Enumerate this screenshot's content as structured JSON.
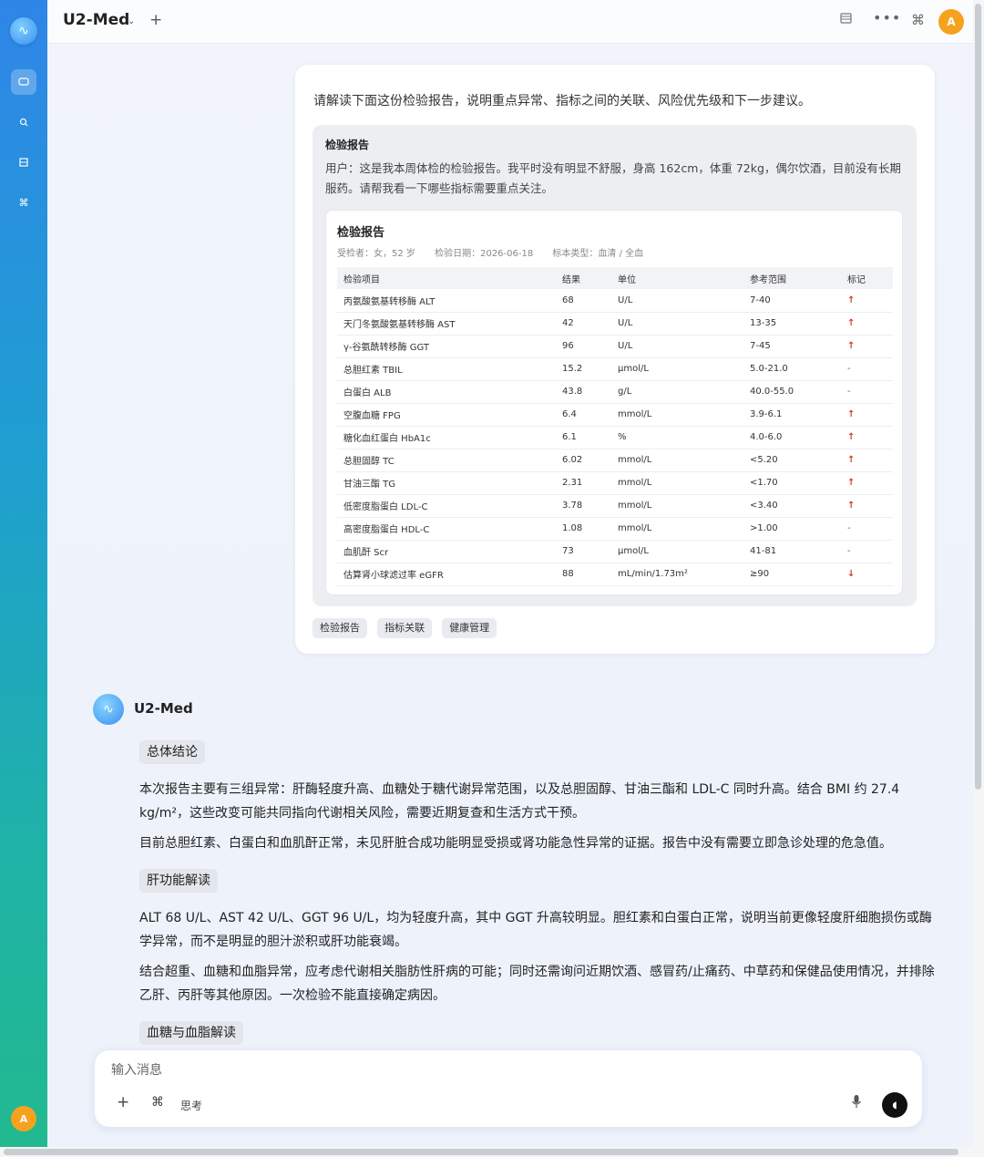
{
  "app": {
    "title": "U2-Med",
    "chevron": "⌄",
    "new_tab": "+"
  },
  "header": {
    "avatar": "A",
    "icons": [
      "sidebar-toggle-icon",
      "more-icon",
      "command-icon"
    ]
  },
  "rail": {
    "logo": "∿",
    "items": [
      "chat-icon",
      "search-icon",
      "library-icon",
      "command-icon"
    ],
    "avatar": "A"
  },
  "user_message": {
    "prompt": "请解读下面这份检验报告，说明重点异常、指标之间的关联、风险优先级和下一步建议。",
    "attachment_title": "检验报告",
    "attachment_desc": "用户：这是我本周体检的检验报告。我平时没有明显不舒服，身高 162cm，体重 72kg，偶尔饮酒，目前没有长期服药。请帮我看一下哪些指标需要重点关注。",
    "report": {
      "title": "检验报告",
      "subject": "受检者：女，52 岁",
      "date": "检验日期：2026-06-18",
      "sample": "标本类型：血清 / 全血",
      "headers": [
        "检验项目",
        "结果",
        "单位",
        "参考范围",
        "标记"
      ],
      "rows": [
        [
          "丙氨酸氨基转移酶 ALT",
          "68",
          "U/L",
          "7-40",
          "↑"
        ],
        [
          "天门冬氨酸氨基转移酶 AST",
          "42",
          "U/L",
          "13-35",
          "↑"
        ],
        [
          "γ-谷氨酰转移酶 GGT",
          "96",
          "U/L",
          "7-45",
          "↑"
        ],
        [
          "总胆红素 TBIL",
          "15.2",
          "μmol/L",
          "5.0-21.0",
          "-"
        ],
        [
          "白蛋白 ALB",
          "43.8",
          "g/L",
          "40.0-55.0",
          "-"
        ],
        [
          "空腹血糖 FPG",
          "6.4",
          "mmol/L",
          "3.9-6.1",
          "↑"
        ],
        [
          "糖化血红蛋白 HbA1c",
          "6.1",
          "%",
          "4.0-6.0",
          "↑"
        ],
        [
          "总胆固醇 TC",
          "6.02",
          "mmol/L",
          "<5.20",
          "↑"
        ],
        [
          "甘油三酯 TG",
          "2.31",
          "mmol/L",
          "<1.70",
          "↑"
        ],
        [
          "低密度脂蛋白 LDL-C",
          "3.78",
          "mmol/L",
          "<3.40",
          "↑"
        ],
        [
          "高密度脂蛋白 HDL-C",
          "1.08",
          "mmol/L",
          ">1.00",
          "-"
        ],
        [
          "血肌酐 Scr",
          "73",
          "μmol/L",
          "41-81",
          "-"
        ],
        [
          "估算肾小球滤过率 eGFR",
          "88",
          "mL/min/1.73m²",
          "≥90",
          "↓"
        ]
      ]
    },
    "tags": [
      "检验报告",
      "指标关联",
      "健康管理"
    ]
  },
  "assistant": {
    "name": "U2-Med",
    "sections": [
      {
        "title": "总体结论",
        "paras": [
          "本次报告主要有三组异常：肝酶轻度升高、血糖处于糖代谢异常范围，以及总胆固醇、甘油三酯和 LDL-C 同时升高。结合 BMI 约 27.4 kg/m²，这些改变可能共同指向代谢相关风险，需要近期复查和生活方式干预。",
          "目前总胆红素、白蛋白和血肌酐正常，未见肝脏合成功能明显受损或肾功能急性异常的证据。报告中没有需要立即急诊处理的危急值。"
        ]
      },
      {
        "title": "肝功能解读",
        "paras": [
          "ALT 68 U/L、AST 42 U/L、GGT 96 U/L，均为轻度升高，其中 GGT 升高较明显。胆红素和白蛋白正常，说明当前更像轻度肝细胞损伤或酶学异常，而不是明显的胆汁淤积或肝功能衰竭。",
          "结合超重、血糖和血脂异常，应考虑代谢相关脂肪性肝病的可能；同时还需询问近期饮酒、感冒药/止痛药、中草药和保健品使用情况，并排除乙肝、丙肝等其他原因。一次检验不能直接确定病因。"
        ]
      },
      {
        "title": "血糖与血脂解读",
        "paras": []
      }
    ]
  },
  "composer": {
    "placeholder": "输入消息",
    "add": "+",
    "cmd": "⌘",
    "think": "思考",
    "mic": "🎙",
    "send": "◖"
  }
}
